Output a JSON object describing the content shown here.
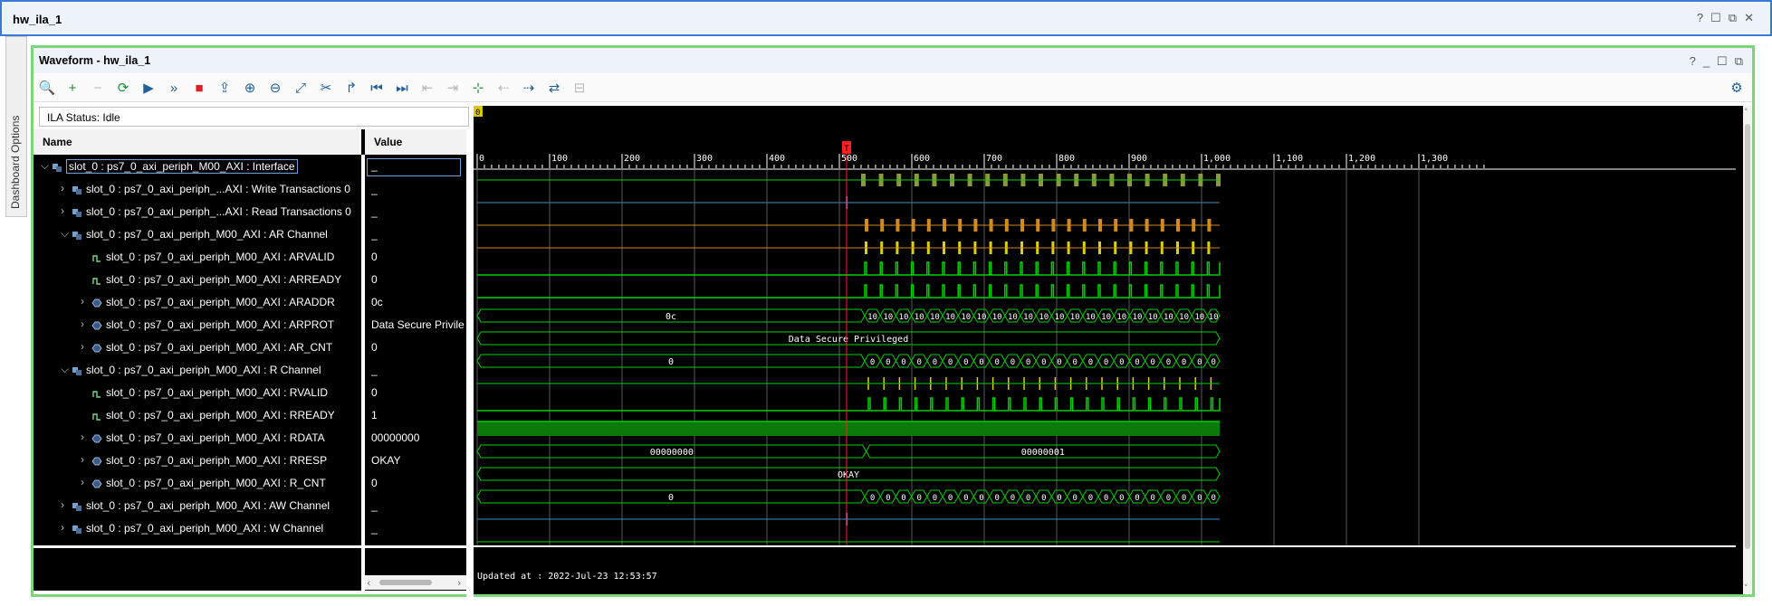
{
  "window": {
    "title": "hw_ila_1",
    "controls": [
      "?",
      "☐",
      "⧉",
      "✕"
    ]
  },
  "side_tab": {
    "label": "Dashboard Options"
  },
  "waveform": {
    "title": "Waveform - hw_ila_1",
    "controls": [
      "?",
      "_",
      "☐",
      "⧉"
    ],
    "status": "ILA Status: Idle",
    "columns": {
      "name": "Name",
      "value": "Value"
    },
    "updated": "Updated at : 2022-Jul-23 12:53:57",
    "trigger_marker": "T",
    "origin_marker": "0",
    "ruler_ticks": [
      "0",
      "100",
      "200",
      "300",
      "400",
      "500",
      "600",
      "700",
      "800",
      "900",
      "1,000",
      "1,100",
      "1,200",
      "1,300"
    ],
    "rows": [
      {
        "level": 0,
        "expander": "⌵",
        "icon": "interface",
        "name": "slot_0 : ps7_0_axi_periph_M00_AXI : Interface",
        "value": "_",
        "selected": true
      },
      {
        "level": 1,
        "expander": "›",
        "icon": "interface",
        "name": "slot_0 : ps7_0_axi_periph_...AXI : Write Transactions 0",
        "value": "_"
      },
      {
        "level": 1,
        "expander": "›",
        "icon": "interface",
        "name": "slot_0 : ps7_0_axi_periph_...AXI : Read Transactions 0",
        "value": "_"
      },
      {
        "level": 1,
        "expander": "⌵",
        "icon": "interface",
        "name": "slot_0 : ps7_0_axi_periph_M00_AXI : AR Channel",
        "value": "_"
      },
      {
        "level": 2,
        "expander": "",
        "icon": "bit",
        "name": "slot_0 : ps7_0_axi_periph_M00_AXI : ARVALID",
        "value": "0"
      },
      {
        "level": 2,
        "expander": "",
        "icon": "bit",
        "name": "slot_0 : ps7_0_axi_periph_M00_AXI : ARREADY",
        "value": "0"
      },
      {
        "level": 2,
        "expander": "›",
        "icon": "bus",
        "name": "slot_0 : ps7_0_axi_periph_M00_AXI : ARADDR",
        "value": "0c"
      },
      {
        "level": 2,
        "expander": "›",
        "icon": "bus",
        "name": "slot_0 : ps7_0_axi_periph_M00_AXI : ARPROT",
        "value": "Data Secure Privile"
      },
      {
        "level": 2,
        "expander": "›",
        "icon": "bus",
        "name": "slot_0 : ps7_0_axi_periph_M00_AXI : AR_CNT",
        "value": "0"
      },
      {
        "level": 1,
        "expander": "⌵",
        "icon": "interface",
        "name": "slot_0 : ps7_0_axi_periph_M00_AXI : R Channel",
        "value": "_"
      },
      {
        "level": 2,
        "expander": "",
        "icon": "bit",
        "name": "slot_0 : ps7_0_axi_periph_M00_AXI : RVALID",
        "value": "0"
      },
      {
        "level": 2,
        "expander": "",
        "icon": "bit",
        "name": "slot_0 : ps7_0_axi_periph_M00_AXI : RREADY",
        "value": "1"
      },
      {
        "level": 2,
        "expander": "›",
        "icon": "bus",
        "name": "slot_0 : ps7_0_axi_periph_M00_AXI : RDATA",
        "value": "00000000"
      },
      {
        "level": 2,
        "expander": "›",
        "icon": "bus",
        "name": "slot_0 : ps7_0_axi_periph_M00_AXI : RRESP",
        "value": "OKAY"
      },
      {
        "level": 2,
        "expander": "›",
        "icon": "bus",
        "name": "slot_0 : ps7_0_axi_periph_M00_AXI : R_CNT",
        "value": "0"
      },
      {
        "level": 1,
        "expander": "›",
        "icon": "interface",
        "name": "slot_0 : ps7_0_axi_periph_M00_AXI : AW Channel",
        "value": "_"
      },
      {
        "level": 1,
        "expander": "›",
        "icon": "interface",
        "name": "slot_0 : ps7_0_axi_periph_M00_AXI : W Channel",
        "value": "_"
      }
    ],
    "bus_labels": {
      "araddr_before": "0c",
      "araddr_after": "10",
      "arprot": "Data Secure Privileged",
      "ar_cnt_before": "0",
      "ar_cnt_after": "0",
      "rdata_before": "00000000",
      "rdata_after": "00000001",
      "rresp": "OKAY",
      "r_cnt_before": "0",
      "r_cnt_after": "0"
    },
    "colors": {
      "wave_green": "#00d000",
      "interface_olive": "#8a9a3a",
      "read_orange": "#d08a20",
      "ar_yellow": "#e0d000",
      "cursor_red": "#ff2020",
      "panel_border": "#7bd67b"
    }
  },
  "toolbar": [
    {
      "icon": "search-icon",
      "glyph": "🔍",
      "enabled": true
    },
    {
      "icon": "add-icon",
      "glyph": "+",
      "enabled": true
    },
    {
      "icon": "remove-icon",
      "glyph": "−",
      "enabled": false
    },
    {
      "icon": "run-trigger-immediate-icon",
      "glyph": "⟳",
      "enabled": true
    },
    {
      "icon": "run-trigger-icon",
      "glyph": "▶",
      "enabled": true
    },
    {
      "icon": "run-immediate-icon",
      "glyph": "»",
      "enabled": true
    },
    {
      "icon": "stop-icon",
      "glyph": "■",
      "enabled": true
    },
    {
      "icon": "export-icon",
      "glyph": "⇪",
      "enabled": true
    },
    {
      "icon": "zoom-in-icon",
      "glyph": "⊕",
      "enabled": true
    },
    {
      "icon": "zoom-out-icon",
      "glyph": "⊖",
      "enabled": true
    },
    {
      "icon": "zoom-fit-icon",
      "glyph": "⤢",
      "enabled": true
    },
    {
      "icon": "cut-icon",
      "glyph": "✂",
      "enabled": true
    },
    {
      "icon": "go-to-cursor-icon",
      "glyph": "↱",
      "enabled": true
    },
    {
      "icon": "go-to-start-icon",
      "glyph": "⏮",
      "enabled": true
    },
    {
      "icon": "go-to-end-icon",
      "glyph": "⏭",
      "enabled": true
    },
    {
      "icon": "prev-transition-icon",
      "glyph": "⇤",
      "enabled": false
    },
    {
      "icon": "next-transition-icon",
      "glyph": "⇥",
      "enabled": false
    },
    {
      "icon": "add-marker-icon",
      "glyph": "⊹",
      "enabled": true
    },
    {
      "icon": "prev-marker-icon",
      "glyph": "⇠",
      "enabled": false
    },
    {
      "icon": "next-marker-icon",
      "glyph": "⇢",
      "enabled": true
    },
    {
      "icon": "swap-cursors-icon",
      "glyph": "⇄",
      "enabled": true
    },
    {
      "icon": "snap-icon",
      "glyph": "⊟",
      "enabled": false
    }
  ],
  "settings_icon": "gear-icon"
}
